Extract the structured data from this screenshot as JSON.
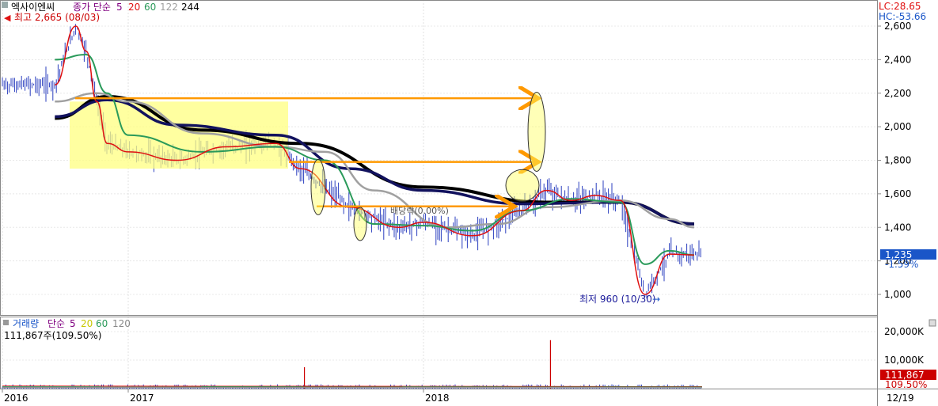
{
  "price_panel": {
    "stock_name": "엑사이엔씨",
    "indicator_title": "종가 단순",
    "ma_periods": [
      "5",
      "20",
      "60",
      "122",
      "244"
    ],
    "high_label": "최고 2,665 (08/03)",
    "low_label": "최저 960 (10/30)",
    "dividend_label": "배당락(0.00%)",
    "lc_label": "LC:28.65",
    "hc_label": "HC:-53.66",
    "current_price_label": "1,235",
    "current_change_label": "-1.59%"
  },
  "volume_panel": {
    "title": "거래량",
    "indicator_title": "단순",
    "ma_periods": [
      "5",
      "20",
      "60",
      "120"
    ],
    "current_volume_label": "111,867주(109.50%)",
    "current_volume_box": "111,867",
    "current_pct_box": "109.50%"
  },
  "date_label": "12/19",
  "colors": {
    "ma5": "#e01010",
    "ma20": "#2a9a5a",
    "ma60": "#a0a0a0",
    "ma122": "#12125e",
    "ma244": "#000000",
    "bar": "#2b3fbf",
    "highlight": "#ffff80",
    "arrow": "#ff9900",
    "price_box": "#1a56c8",
    "volume_box": "#cc0000"
  },
  "chart_data": [
    {
      "type": "line",
      "name": "price",
      "y_ticks": [
        1000,
        1200,
        1400,
        1600,
        1800,
        2000,
        2200,
        2400,
        2600
      ],
      "ylim": [
        850,
        2750
      ],
      "x_ticks": [
        "2016",
        "2017",
        "2018"
      ],
      "series": [
        {
          "name": "5",
          "x": [
            "2016-06",
            "2016-08",
            "2016-09",
            "2016-10",
            "2016-11",
            "2017-01",
            "2017-03",
            "2017-05",
            "2017-07",
            "2017-08",
            "2017-10",
            "2017-12",
            "2018-01",
            "2018-03",
            "2018-05",
            "2018-06",
            "2018-07",
            "2018-08",
            "2018-09",
            "2018-10",
            "2018-11",
            "2018-12"
          ],
          "values": [
            2250,
            2600,
            2450,
            2150,
            1900,
            1850,
            1800,
            1880,
            1900,
            1750,
            1520,
            1400,
            1430,
            1350,
            1500,
            1620,
            1560,
            1590,
            1560,
            1000,
            1240,
            1235
          ]
        },
        {
          "name": "20",
          "x": [
            "2016-06",
            "2016-09",
            "2016-11",
            "2017-01",
            "2017-04",
            "2017-07",
            "2017-09",
            "2017-11",
            "2018-01",
            "2018-03",
            "2018-05",
            "2018-07",
            "2018-09",
            "2018-10",
            "2018-11",
            "2018-12"
          ],
          "values": [
            2400,
            2430,
            2200,
            1950,
            1850,
            1880,
            1800,
            1420,
            1410,
            1380,
            1500,
            1570,
            1550,
            1180,
            1260,
            1235
          ]
        },
        {
          "name": "60",
          "x": [
            "2016-06",
            "2016-10",
            "2017-01",
            "2017-04",
            "2017-07",
            "2017-09",
            "2017-11",
            "2018-02",
            "2018-04",
            "2018-06",
            "2018-09",
            "2018-11",
            "2018-12"
          ],
          "values": [
            2150,
            2200,
            2150,
            1960,
            1880,
            1850,
            1620,
            1400,
            1420,
            1520,
            1560,
            1450,
            1400
          ]
        },
        {
          "name": "122",
          "x": [
            "2016-06",
            "2016-11",
            "2017-03",
            "2017-07",
            "2017-10",
            "2018-01",
            "2018-05",
            "2018-09",
            "2018-12"
          ],
          "values": [
            2060,
            2160,
            2010,
            1950,
            1750,
            1620,
            1540,
            1550,
            1420
          ]
        },
        {
          "name": "244",
          "x": [
            "2016-06",
            "2016-11",
            "2017-04",
            "2017-08",
            "2018-01",
            "2018-06",
            "2018-09",
            "2018-12"
          ],
          "values": [
            2050,
            2180,
            1980,
            1900,
            1640,
            1550,
            1550,
            1420
          ]
        }
      ]
    },
    {
      "type": "bar",
      "name": "volume",
      "y_ticks": [
        "10,000K",
        "20,000K"
      ],
      "ylim": [
        0,
        24000
      ],
      "spikes": [
        {
          "x": "2017-08",
          "value": 7500
        },
        {
          "x": "2018-06",
          "value": 17000
        }
      ]
    }
  ]
}
